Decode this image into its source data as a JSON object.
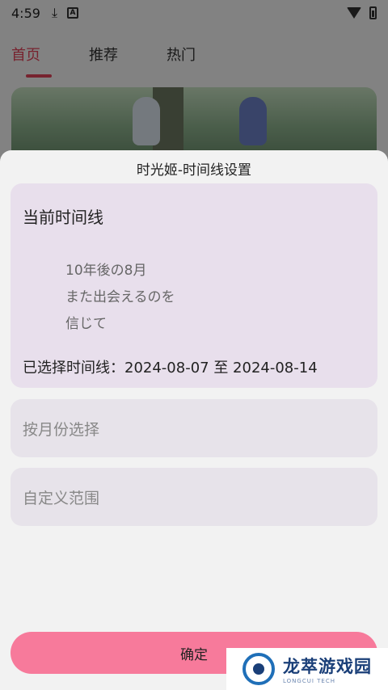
{
  "statusbar": {
    "time": "4:59",
    "icons": [
      "download-icon",
      "a-badge-icon",
      "wifi-icon",
      "battery-icon"
    ]
  },
  "tabs": [
    {
      "label": "首页",
      "active": true
    },
    {
      "label": "推荐",
      "active": false
    },
    {
      "label": "热门",
      "active": false
    }
  ],
  "sheet": {
    "title": "时光姬-时间线设置",
    "current": {
      "heading": "当前时间线",
      "poem": [
        "10年後の8月",
        "また出会えるのを",
        "信じて"
      ],
      "selected": "已选择时间线：2024-08-07 至 2024-08-14"
    },
    "options": {
      "by_month": "按月份选择",
      "custom_range": "自定义范围"
    },
    "confirm_label": "确定"
  },
  "watermark": {
    "cn": "龙萃游戏园",
    "en": "LONGCUI TECH"
  },
  "colors": {
    "accent": "#e5435b",
    "button": "#f77a9b",
    "card": "#e8dfec"
  }
}
